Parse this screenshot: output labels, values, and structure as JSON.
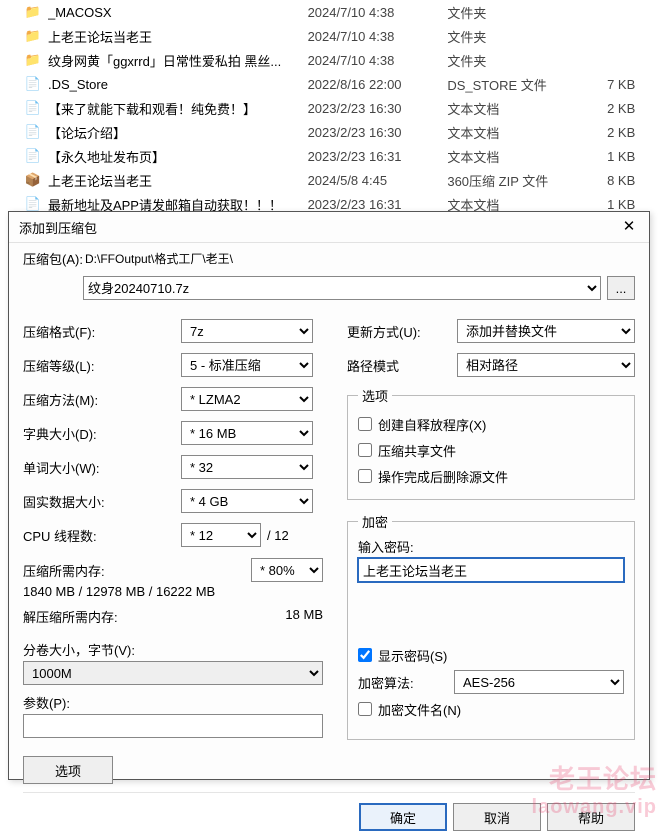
{
  "icons": {
    "folder": "📁",
    "file": "📄",
    "zip": "📦"
  },
  "files": [
    {
      "icon": "folder",
      "name": "_MACOSX",
      "date": "2024/7/10 4:38",
      "type": "文件夹",
      "size": ""
    },
    {
      "icon": "folder",
      "name": "上老王论坛当老王",
      "date": "2024/7/10 4:38",
      "type": "文件夹",
      "size": ""
    },
    {
      "icon": "folder",
      "name": "纹身网黄「ggxrrd」日常性爱私拍 黑丝...",
      "date": "2024/7/10 4:38",
      "type": "文件夹",
      "size": ""
    },
    {
      "icon": "file",
      "name": ".DS_Store",
      "date": "2022/8/16 22:00",
      "type": "DS_STORE 文件",
      "size": "7 KB"
    },
    {
      "icon": "file",
      "name": "【来了就能下载和观看！纯免费！】",
      "date": "2023/2/23 16:30",
      "type": "文本文档",
      "size": "2 KB"
    },
    {
      "icon": "file",
      "name": "【论坛介绍】",
      "date": "2023/2/23 16:30",
      "type": "文本文档",
      "size": "2 KB"
    },
    {
      "icon": "file",
      "name": "【永久地址发布页】",
      "date": "2023/2/23 16:31",
      "type": "文本文档",
      "size": "1 KB"
    },
    {
      "icon": "zip",
      "name": "上老王论坛当老王",
      "date": "2024/5/8 4:45",
      "type": "360压缩 ZIP 文件",
      "size": "8 KB"
    },
    {
      "icon": "file",
      "name": "最新地址及APP请发邮箱自动获取！！！",
      "date": "2023/2/23 16:31",
      "type": "文本文档",
      "size": "1 KB"
    }
  ],
  "dialog": {
    "title": "添加到压缩包",
    "close": "✕",
    "archive_label": "压缩包(A):",
    "archive_path": "D:\\FFOutput\\格式工厂\\老王\\",
    "archive_name": "纹身20240710.7z",
    "browse": "...",
    "left": {
      "format_label": "压缩格式(F):",
      "format_value": "7z",
      "level_label": "压缩等级(L):",
      "level_value": "5 - 标准压缩",
      "method_label": "压缩方法(M):",
      "method_value": "* LZMA2",
      "dict_label": "字典大小(D):",
      "dict_value": "* 16 MB",
      "word_label": "单词大小(W):",
      "word_value": "* 32",
      "solid_label": "固实数据大小:",
      "solid_value": "* 4 GB",
      "cpu_label": "CPU 线程数:",
      "cpu_value": "* 12",
      "cpu_suffix": "/ 12",
      "mem_comp_label": "压缩所需内存:",
      "mem_comp_opt": "* 80%",
      "mem_comp_line": "1840 MB / 12978 MB / 16222 MB",
      "mem_decomp_label": "解压缩所需内存:",
      "mem_decomp_value": "18 MB",
      "split_label": "分卷大小，字节(V):",
      "split_value": "1000M",
      "params_label": "参数(P):",
      "params_value": "",
      "options_btn": "选项"
    },
    "right": {
      "update_label": "更新方式(U):",
      "update_value": "添加并替换文件",
      "pathmode_label": "路径模式",
      "pathmode_value": "相对路径",
      "options_legend": "选项",
      "opt_sfx": "创建自释放程序(X)",
      "opt_share": "压缩共享文件",
      "opt_delete": "操作完成后删除源文件",
      "enc_legend": "加密",
      "enc_pwd_label": "输入密码:",
      "enc_pwd_value": "上老王论坛当老王",
      "enc_show": "显示密码(S)",
      "enc_algo_label": "加密算法:",
      "enc_algo_value": "AES-256",
      "enc_names": "加密文件名(N)"
    },
    "buttons": {
      "ok": "确定",
      "cancel": "取消",
      "help": "帮助"
    }
  },
  "watermark": {
    "line1": "老王论坛",
    "line2": "laowang.vip"
  }
}
